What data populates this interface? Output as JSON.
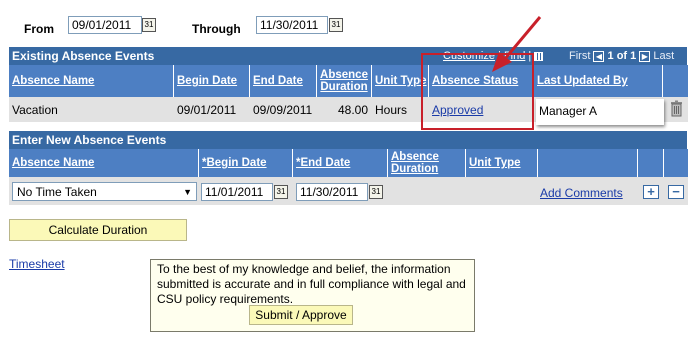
{
  "filters": {
    "from_label": "From",
    "from_value": "09/01/2011",
    "through_label": "Through",
    "through_value": "11/30/2011"
  },
  "existing": {
    "title": "Existing Absence Events",
    "customize": "Customize",
    "find": "Find",
    "first": "First",
    "range": "1 of 1",
    "last": "Last",
    "columns": {
      "absence_name": "Absence Name",
      "begin_date": "Begin Date",
      "end_date": "End Date",
      "absence_duration": "Absence Duration",
      "unit_type": "Unit Type",
      "absence_status": "Absence Status",
      "last_updated_by": "Last Updated By"
    },
    "row": {
      "absence_name": "Vacation",
      "begin_date": "09/01/2011",
      "end_date": "09/09/2011",
      "duration": "48.00",
      "unit_type": "Hours",
      "status": "Approved",
      "last_updated_by": "Manager A"
    }
  },
  "new_events": {
    "title": "Enter New Absence Events",
    "columns": {
      "absence_name": "Absence Name",
      "begin_date": "*Begin Date",
      "end_date": "*End Date",
      "absence_duration": "Absence Duration",
      "unit_type": "Unit Type"
    },
    "row": {
      "absence_name": "No Time Taken",
      "begin_date": "11/01/2011",
      "end_date": "11/30/2011",
      "add_comments": "Add Comments"
    },
    "add_symbol": "+",
    "remove_symbol": "−"
  },
  "calculate_button": "Calculate Duration",
  "timesheet_link": "Timesheet",
  "notice": {
    "text": "To the best of my knowledge and belief, the information submitted is accurate and in full compliance with legal and CSU policy requirements.",
    "button": "Submit / Approve"
  },
  "colors": {
    "grid_title": "#3769a3",
    "grid_header": "#4d7fc3",
    "annotation": "#c8202a",
    "button_yellow": "#fbf9b8"
  },
  "icons": {
    "calendar": "calendar-icon",
    "trash": "trash-icon",
    "arrow": "annotation-arrow"
  }
}
